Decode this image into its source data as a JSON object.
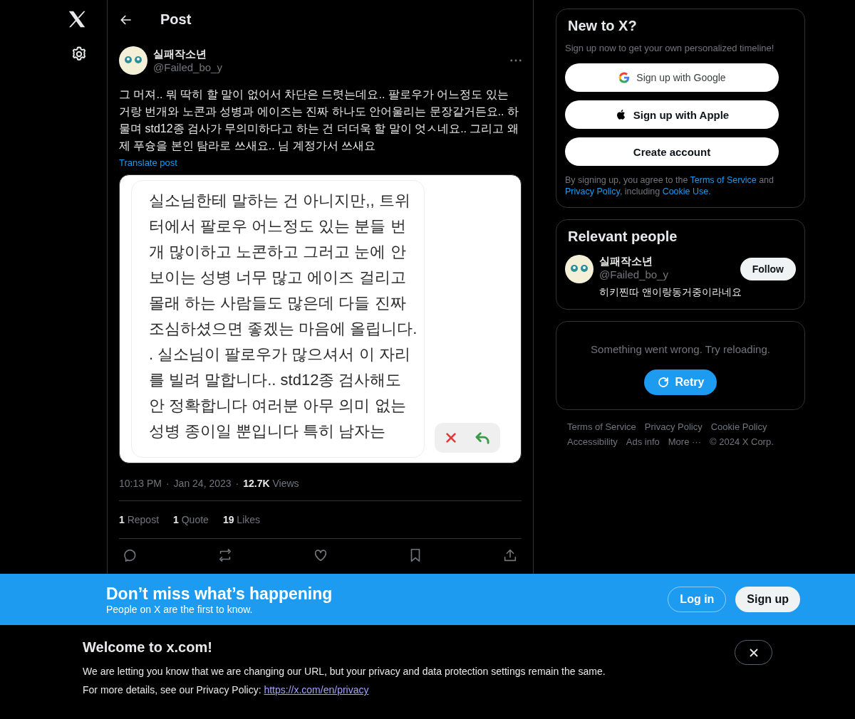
{
  "header": {
    "title": "Post"
  },
  "post": {
    "author": {
      "name": "실패작소년",
      "handle": "@Failed_bo_y"
    },
    "text": "그 머져.. 뭐 딱히 할 말이 없어서 차단은 드렷는데요.. 팔로우가 어느정도 있는 거랑 번개와 노콘과 성병과 에이즈는 진짜 하나도 안어울리는 문장같거든요.. 하물며 std12종 검사가 무의미하다고 하는 건 더더욱 할 말이 엇ㅅ네요.. 그리고 왜 제 푸슝을 본인 탐라로 쓰새요.. 님 계정가서 쓰새요",
    "translate": "Translate post",
    "image": {
      "lines": [
        "실소님한테 말하는 건 아니지만,, 트위",
        "터에서 팔로우 어느정도 있는 분들 번",
        "개 많이하고 노콘하고 그러고 눈에 안",
        "보이는 성병 너무 많고 에이즈 걸리고",
        "몰래 하는 사람들도 많은데 다들 진짜",
        "조심하셨으면 좋겠는 마음에 올립니다.",
        ". 실소님이 팔로우가 많으셔서 이 자리",
        "를 빌려 말합니다.. std12종 검사해도",
        "안 정확합니다 여러분 아무 의미 없는",
        "성병 종이일 뿐입니다 특히 남자는"
      ]
    },
    "time": "10:13 PM",
    "separator": "·",
    "date": "Jan 24, 2023",
    "views": {
      "count": "12.7K",
      "label": "Views"
    },
    "stats": [
      {
        "count": "1",
        "label": "Repost"
      },
      {
        "count": "1",
        "label": "Quote"
      },
      {
        "count": "19",
        "label": "Likes"
      }
    ]
  },
  "signup": {
    "title": "New to X?",
    "subtitle": "Sign up now to get your own personalized timeline!",
    "buttons": [
      {
        "kind": "google",
        "label": "Sign up with Google"
      },
      {
        "kind": "apple",
        "label": "Sign up with Apple"
      },
      {
        "kind": "plain",
        "label": "Create account"
      }
    ],
    "legal": [
      {
        "kind": "text",
        "text": "By signing up, you agree to the "
      },
      {
        "kind": "link",
        "text": "Terms of Service"
      },
      {
        "kind": "text",
        "text": " and "
      },
      {
        "kind": "link",
        "text": "Privacy Policy"
      },
      {
        "kind": "text",
        "text": ", including "
      },
      {
        "kind": "link",
        "text": "Cookie Use."
      }
    ]
  },
  "relevant": {
    "title": "Relevant people",
    "people": [
      {
        "name": "실패작소년",
        "handle": "@Failed_bo_y",
        "bio": "히키찐따 앤이랑동거중이라네요",
        "button": "Follow"
      }
    ]
  },
  "error": {
    "message": "Something went wrong. Try reloading.",
    "button": "Retry"
  },
  "footer": {
    "links": [
      "Terms of Service",
      "Privacy Policy",
      "Cookie Policy",
      "Accessibility",
      "Ads info",
      "More ···"
    ],
    "copyright": "© 2024 X Corp."
  },
  "banner": {
    "title": "Don’t miss what’s happening",
    "subtitle": "People on X are the first to know.",
    "buttons": [
      {
        "kind": "outline",
        "label": "Log in"
      },
      {
        "kind": "filled",
        "label": "Sign up"
      }
    ]
  },
  "notice": {
    "title": "Welcome to x.com!",
    "body": "We are letting you know that we are changing our URL, but your privacy and data protection settings remain the same.",
    "details": [
      {
        "kind": "text",
        "text": "For more details, see our Privacy Policy: "
      },
      {
        "kind": "link",
        "text": "https://x.com/en/privacy"
      }
    ]
  }
}
